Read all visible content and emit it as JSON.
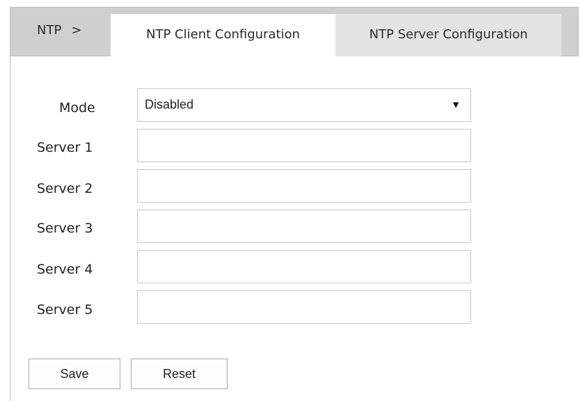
{
  "breadcrumb": {
    "root": "NTP",
    "separator": ">"
  },
  "tabs": [
    {
      "label": "NTP Client Configuration",
      "active": true
    },
    {
      "label": "NTP Server Configuration",
      "active": false
    }
  ],
  "form": {
    "mode": {
      "label": "Mode",
      "value": "Disabled"
    },
    "servers": [
      {
        "label": "Server 1",
        "value": ""
      },
      {
        "label": "Server 2",
        "value": ""
      },
      {
        "label": "Server 3",
        "value": ""
      },
      {
        "label": "Server 4",
        "value": ""
      },
      {
        "label": "Server 5",
        "value": ""
      }
    ]
  },
  "buttons": {
    "save": "Save",
    "reset": "Reset"
  },
  "icons": {
    "dropdown": "caret-down-icon"
  },
  "colors": {
    "header_bg": "#cfcfcf",
    "active_tab_bg": "#ffffff",
    "inactive_tab_bg": "#e3e3e3",
    "border": "#c8c8c8"
  }
}
